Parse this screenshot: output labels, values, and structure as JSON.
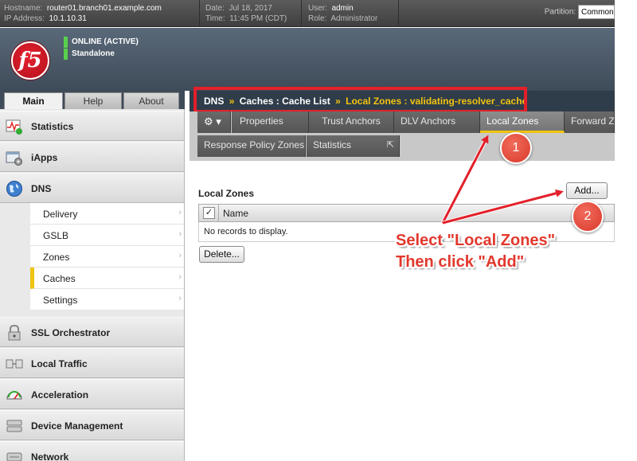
{
  "header": {
    "hostname_label": "Hostname:",
    "hostname": "router01.branch01.example.com",
    "ip_label": "IP Address:",
    "ip": "10.1.10.31",
    "date_label": "Date:",
    "date": "Jul 18, 2017",
    "time_label": "Time:",
    "time": "11:45 PM (CDT)",
    "user_label": "User:",
    "user": "admin",
    "role_label": "Role:",
    "role": "Administrator",
    "partition_label": "Partition:",
    "partition_value": "Common"
  },
  "banner": {
    "logo_text": "f5",
    "status_line1": "ONLINE (ACTIVE)",
    "status_line2": "Standalone"
  },
  "left_tabs": [
    "Main",
    "Help",
    "About"
  ],
  "nav": {
    "statistics": "Statistics",
    "iapps": "iApps",
    "dns": "DNS",
    "dns_children": [
      "Delivery",
      "GSLB",
      "Zones",
      "Caches",
      "Settings"
    ],
    "selected_child": "Caches",
    "ssl_orchestrator": "SSL Orchestrator",
    "local_traffic": "Local Traffic",
    "acceleration": "Acceleration",
    "device_management": "Device Management",
    "network": "Network"
  },
  "breadcrumb": {
    "root": "DNS",
    "sep1": "»",
    "middle": "Caches : Cache List",
    "sep2": "»",
    "current": "Local Zones : validating-resolver_cache"
  },
  "tabs": {
    "gear": "⚙ ▾",
    "properties": "Properties",
    "trust_anchors": "Trust Anchors",
    "dlv_anchors": "DLV Anchors",
    "local_zones": "Local Zones",
    "forward_zones": "Forward Zones",
    "response_policy_zones": "Response Policy Zones",
    "statistics": "Statistics",
    "statistics_icon": "⇱"
  },
  "content": {
    "section_title": "Local Zones",
    "add_button": "Add...",
    "checkbox_mark": "✓",
    "column_name": "Name",
    "empty_message": "No records to display.",
    "delete_button": "Delete..."
  },
  "annotations": {
    "marker1": "1",
    "marker2": "2",
    "callout_line1": "Select \"Local Zones\"",
    "callout_line2": "Then click \"Add\"",
    "arrow_color": "#e2202a"
  },
  "colors": {
    "accent_yellow": "#f1c40f",
    "status_green": "#5ad04c",
    "annotation_red": "#e2202a"
  }
}
